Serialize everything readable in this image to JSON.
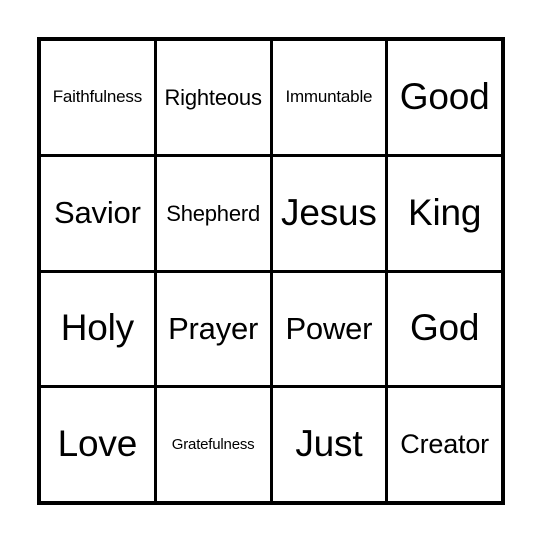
{
  "card": {
    "type": "bingo-card",
    "columns": 4,
    "rows": 4,
    "border_color": "#000000",
    "background_color": "#ffffff",
    "text_color": "#000000",
    "cells": [
      {
        "label": "Faithfulness",
        "size": "sm",
        "row": 1,
        "col": 1
      },
      {
        "label": "Righteous",
        "size": "md",
        "row": 1,
        "col": 2
      },
      {
        "label": "Immuntable",
        "size": "sm",
        "row": 1,
        "col": 3
      },
      {
        "label": "Good",
        "size": "xxl",
        "row": 1,
        "col": 4
      },
      {
        "label": "Savior",
        "size": "xl",
        "row": 2,
        "col": 1
      },
      {
        "label": "Shepherd",
        "size": "md",
        "row": 2,
        "col": 2
      },
      {
        "label": "Jesus",
        "size": "xxl",
        "row": 2,
        "col": 3
      },
      {
        "label": "King",
        "size": "xxl",
        "row": 2,
        "col": 4
      },
      {
        "label": "Holy",
        "size": "xxl",
        "row": 3,
        "col": 1
      },
      {
        "label": "Prayer",
        "size": "xl",
        "row": 3,
        "col": 2
      },
      {
        "label": "Power",
        "size": "xl",
        "row": 3,
        "col": 3
      },
      {
        "label": "God",
        "size": "xxl",
        "row": 3,
        "col": 4
      },
      {
        "label": "Love",
        "size": "xxl",
        "row": 4,
        "col": 1
      },
      {
        "label": "Gratefulness",
        "size": "xs",
        "row": 4,
        "col": 2
      },
      {
        "label": "Just",
        "size": "xxl",
        "row": 4,
        "col": 3
      },
      {
        "label": "Creator",
        "size": "lg",
        "row": 4,
        "col": 4
      }
    ]
  }
}
